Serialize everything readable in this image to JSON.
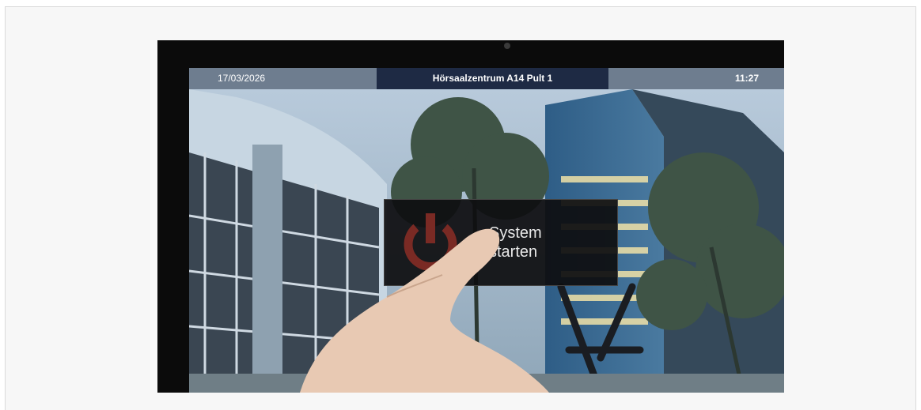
{
  "status_bar": {
    "date": "17/03/2026",
    "location": "Hörsaalzentrum A14  Pult 1",
    "time": "11:27"
  },
  "start_button": {
    "label": "System\nstarten",
    "icon": "power-icon"
  },
  "colors": {
    "status_bar": "#6e7d8f",
    "status_bar_center": "#1e2a44",
    "button_background": "#0e0e10",
    "power_icon": "#7a2a24"
  }
}
